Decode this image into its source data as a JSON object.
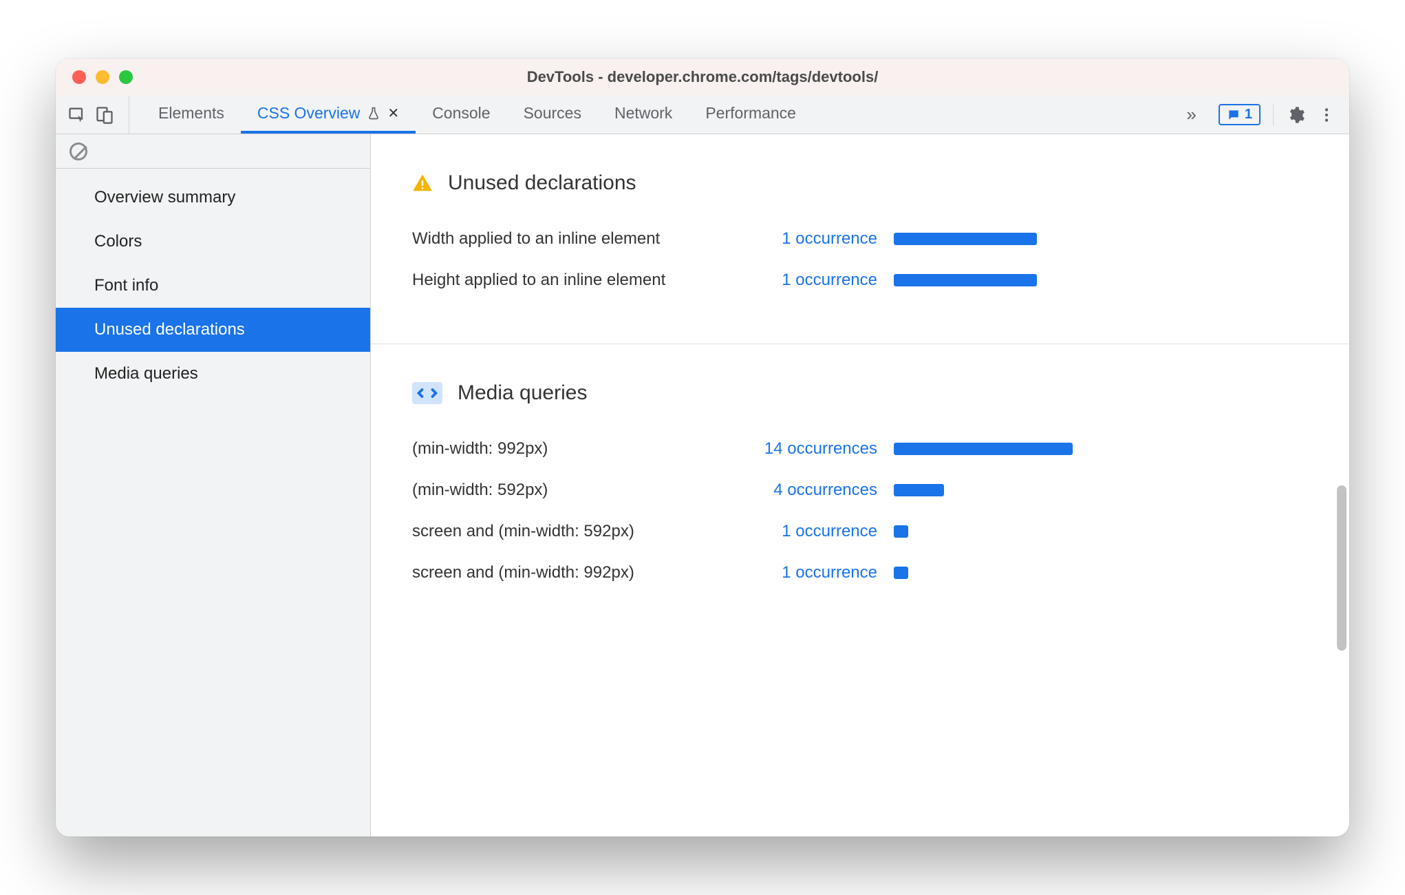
{
  "window": {
    "title": "DevTools - developer.chrome.com/tags/devtools/"
  },
  "tabstrip": {
    "tabs": [
      {
        "label": "Elements"
      },
      {
        "label": "CSS Overview",
        "active": true,
        "experiment": true,
        "closable": true
      },
      {
        "label": "Console"
      },
      {
        "label": "Sources"
      },
      {
        "label": "Network"
      },
      {
        "label": "Performance"
      }
    ],
    "messages_count": "1"
  },
  "sidebar": {
    "items": [
      {
        "label": "Overview summary"
      },
      {
        "label": "Colors"
      },
      {
        "label": "Font info"
      },
      {
        "label": "Unused declarations",
        "selected": true
      },
      {
        "label": "Media queries"
      }
    ]
  },
  "sections": {
    "unused": {
      "title": "Unused declarations",
      "rows": [
        {
          "label": "Width applied to an inline element",
          "count_text": "1 occurrence",
          "bar_pct": 80
        },
        {
          "label": "Height applied to an inline element",
          "count_text": "1 occurrence",
          "bar_pct": 80
        }
      ]
    },
    "media": {
      "title": "Media queries",
      "rows": [
        {
          "label": "(min-width: 992px)",
          "count_text": "14 occurrences",
          "bar_pct": 100
        },
        {
          "label": "(min-width: 592px)",
          "count_text": "4 occurrences",
          "bar_pct": 28
        },
        {
          "label": "screen and (min-width: 592px)",
          "count_text": "1 occurrence",
          "bar_pct": 8
        },
        {
          "label": "screen and (min-width: 992px)",
          "count_text": "1 occurrence",
          "bar_pct": 8
        }
      ]
    }
  },
  "colors": {
    "accent": "#1a73e8"
  }
}
